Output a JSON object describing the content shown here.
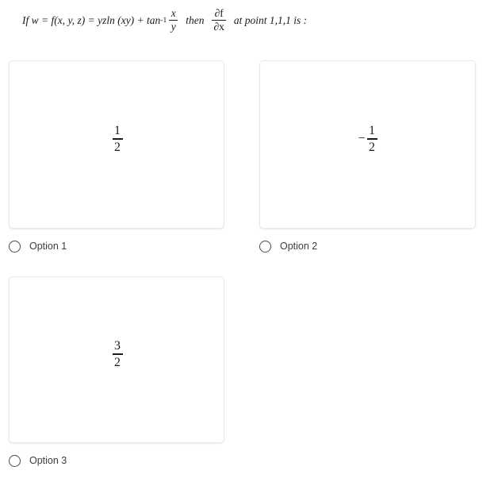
{
  "question": {
    "prefix": "If w = f(x, y, z) = yzln (xy) + tan",
    "tan_exponent": "-1",
    "arctan_fraction": {
      "numerator": "x",
      "denominator": "y"
    },
    "connector": "then",
    "partial_fraction": {
      "numerator": "∂f",
      "denominator": "∂x"
    },
    "suffix": "at point 1,1,1 is :"
  },
  "options": [
    {
      "id": "option-1",
      "label": "Option 1",
      "selected": false,
      "value": {
        "sign": "",
        "numerator": "1",
        "denominator": "2"
      }
    },
    {
      "id": "option-2",
      "label": "Option 2",
      "selected": false,
      "value": {
        "sign": "−",
        "numerator": "1",
        "denominator": "2"
      }
    },
    {
      "id": "option-3",
      "label": "Option 3",
      "selected": false,
      "value": {
        "sign": "",
        "numerator": "3",
        "denominator": "2"
      }
    }
  ],
  "colors": {
    "text": "#1a1a1a",
    "label_text": "#3c3c3c",
    "card_border": "#e8e8e8",
    "radio_border": "#4a4a4a",
    "background": "#ffffff"
  }
}
